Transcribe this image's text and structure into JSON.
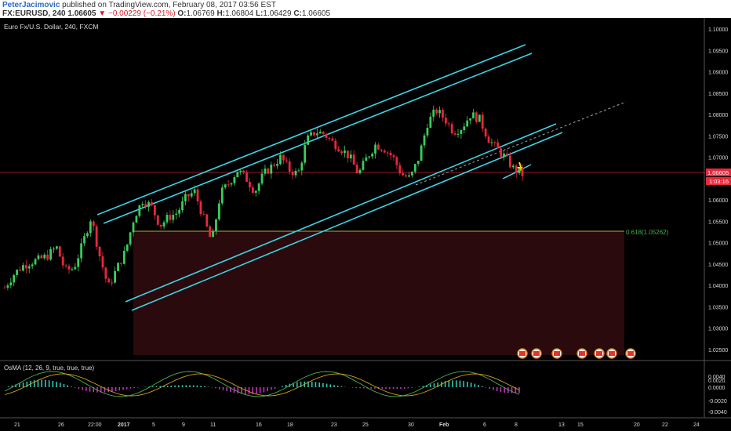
{
  "header": {
    "author": "PeterJacimovic",
    "published_text": "published on TradingView.com, February 08, 2017 03:56 EST",
    "symbol": "FX:EURUSD, 240",
    "price": "1.06605",
    "arrow": "▼",
    "change": "−0.00229 (−0.21%)",
    "o_label": "O:",
    "o_value": "1.06769",
    "h_label": "H:",
    "h_value": "1.06804",
    "l_label": "L:",
    "l_value": "1.06429",
    "c_label": "C:",
    "c_value": "1.06605"
  },
  "chart": {
    "title": "Euro Fx/U.S. Dollar, 240, FXCM",
    "current_price_label": "1.06605",
    "countdown_label": "1:03:16",
    "fib_label": "0.618(1.05262)"
  },
  "chart_data": {
    "type": "candlestick",
    "instrument": "Euro Fx/U.S. Dollar",
    "timeframe": "240",
    "y_ticks": [
      "1.10000",
      "1.09500",
      "1.09000",
      "1.08500",
      "1.08000",
      "1.07500",
      "1.07000",
      "1.06500",
      "1.06000",
      "1.05500",
      "1.05000",
      "1.04500",
      "1.04000",
      "1.03500",
      "1.03000",
      "1.02500"
    ],
    "ylim": [
      1.02,
      1.1025
    ],
    "x_ticks": [
      "21",
      "26",
      "22:00",
      "2017",
      "5",
      "9",
      "11",
      "16",
      "18",
      "23",
      "25",
      "30",
      "Feb",
      "6",
      "8",
      "13",
      "15",
      "20",
      "22",
      "24"
    ],
    "close_path": [
      1.0395,
      1.0425,
      1.0445,
      1.0455,
      1.046,
      1.047,
      1.049,
      1.0435,
      1.044,
      1.0495,
      1.056,
      1.047,
      1.0395,
      1.044,
      1.048,
      1.056,
      1.06,
      1.0585,
      1.054,
      1.056,
      1.057,
      1.0605,
      1.062,
      1.056,
      1.05,
      1.0615,
      1.064,
      1.067,
      1.065,
      1.062,
      1.066,
      1.068,
      1.07,
      1.067,
      1.066,
      1.074,
      1.076,
      1.0755,
      1.0735,
      1.072,
      1.07,
      1.066,
      1.07,
      1.073,
      1.072,
      1.07,
      1.066,
      1.065,
      1.07,
      1.078,
      1.081,
      1.079,
      1.076,
      1.077,
      1.08,
      1.079,
      1.0745,
      1.072,
      1.07,
      1.0672,
      1.066
    ],
    "current_price": 1.06605,
    "fib_level": 1.05262,
    "fib_ratio": 0.618,
    "oscillator": {
      "name": "OsMA (12, 26, 9, true, true, true)",
      "y_ticks": [
        "0.0040",
        "0.0020",
        "0.0000",
        "-0.0020",
        "-0.0040"
      ],
      "ylim": [
        -0.005,
        0.005
      ]
    }
  },
  "colors": {
    "background": "#000000",
    "candle_up": "#3acd5c",
    "candle_down": "#e8283c",
    "channel": "#3cd4e8",
    "price_label_bg": "#e8283c",
    "fib_line": "#b4a83c",
    "fib_text": "#4aa84a",
    "osma_pos": "#2ec8b8",
    "osma_neg": "#c032c0",
    "axis_text": "#d8d8d8"
  }
}
